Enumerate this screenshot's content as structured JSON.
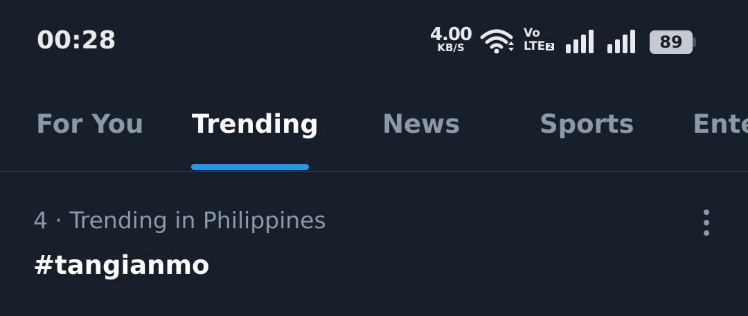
{
  "status_bar": {
    "time": "00:28",
    "net_speed_value": "4.00",
    "net_speed_unit": "KB/S",
    "volte_top": "Vo",
    "volte_bottom": "LTE",
    "sim_slot": "2",
    "battery_level": "89",
    "icons": [
      "wifi-icon",
      "signal-strength-icon",
      "signal-strength-icon",
      "battery-icon"
    ]
  },
  "tabs": [
    {
      "label": "For You",
      "active": false
    },
    {
      "label": "Trending",
      "active": true
    },
    {
      "label": "News",
      "active": false
    },
    {
      "label": "Sports",
      "active": false
    },
    {
      "label": "Entertainment",
      "active": false
    }
  ],
  "trend": {
    "meta": "4 · Trending in Philippines",
    "title": "#tangianmo",
    "more_icon": "more-vertical-icon"
  },
  "colors": {
    "background": "#17202a",
    "accent": "#1d9bf0",
    "muted_text": "#8b98a5",
    "primary_text": "#ffffff"
  }
}
